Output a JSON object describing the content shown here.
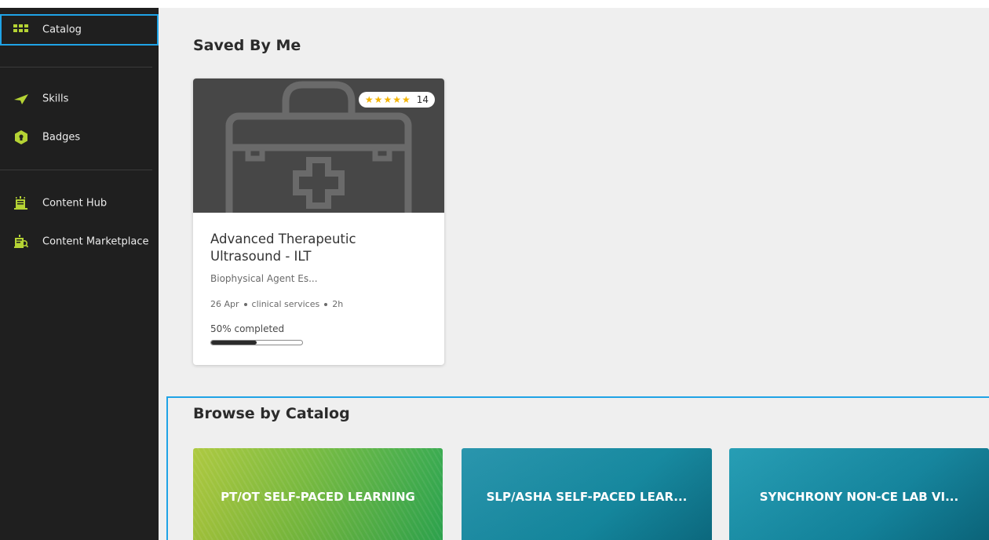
{
  "sidebar": {
    "items": [
      {
        "label": "Catalog",
        "icon": "catalog-grid-icon"
      },
      {
        "label": "Skills",
        "icon": "paper-plane-icon"
      },
      {
        "label": "Badges",
        "icon": "badge-hexagon-icon"
      },
      {
        "label": "Content Hub",
        "icon": "content-hub-icon"
      },
      {
        "label": "Content Marketplace",
        "icon": "content-marketplace-icon"
      }
    ]
  },
  "saved": {
    "title": "Saved By Me",
    "card": {
      "icon": "medical-kit-icon",
      "rating_count": "14",
      "rating_stars": 5,
      "title": "Advanced Therapeutic Ultrasound - ILT",
      "subtitle": "Biophysical Agent Es...",
      "date": "26 Apr",
      "category": "clinical services",
      "duration": "2h",
      "progress_text": "50% completed",
      "progress": 0.5
    }
  },
  "browse": {
    "title": "Browse by Catalog",
    "tiles": [
      {
        "label": "PT/OT SELF-PACED LEARNING"
      },
      {
        "label": "SLP/ASHA SELF-PACED LEAR..."
      },
      {
        "label": "SYNCHRONY NON-CE LAB VI..."
      }
    ]
  },
  "colors": {
    "sidebar_bg": "#1f1f1f",
    "accent_green": "#b5d334",
    "selection_outline": "#1fa3e6",
    "star_color": "#f4b400"
  }
}
